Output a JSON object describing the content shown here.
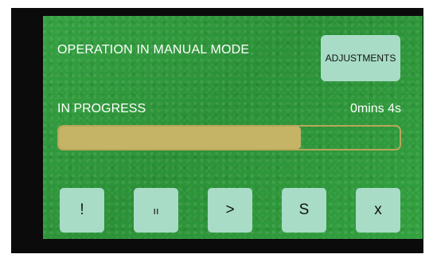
{
  "panel": {
    "title": "OPERATION IN MANUAL MODE",
    "adjustments_label": "ADJUSTMENTS",
    "status_label": "IN PROGRESS",
    "elapsed_time": "0mins 4s"
  },
  "progress": {
    "fraction": 0.71
  },
  "controls": [
    {
      "label": "!",
      "icon": "alert"
    },
    {
      "label": "ıı",
      "icon": "pause"
    },
    {
      "label": ">",
      "icon": "play"
    },
    {
      "label": "S",
      "icon": "step"
    },
    {
      "label": "x",
      "icon": "stop"
    }
  ],
  "colors": {
    "screen_background": "#2f9a3b",
    "button_fill": "#a8dcc6",
    "progress_fill": "#c5b466",
    "progress_border": "#b9a659",
    "bezel": "#0b0b0b"
  }
}
